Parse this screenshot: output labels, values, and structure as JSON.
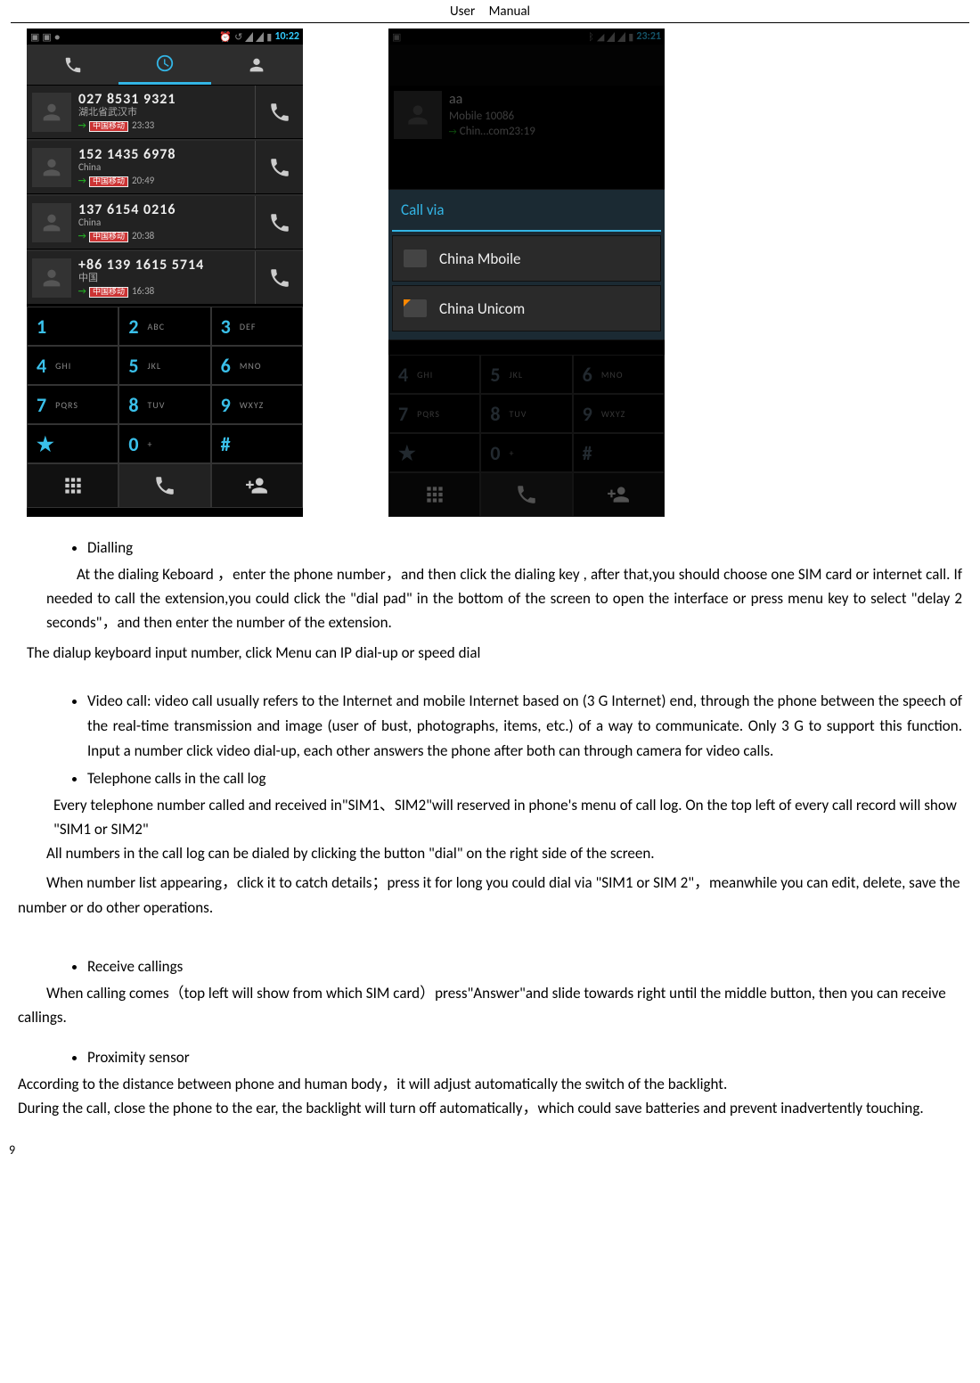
{
  "header": {
    "title": "User Manual"
  },
  "page_number": "9",
  "phone1": {
    "time": "10:22",
    "calls": [
      {
        "num": "027 8531 9321",
        "loc": "湖北省武汉市",
        "tag": "中国移动",
        "time": "23:33"
      },
      {
        "num": "152 1435 6978",
        "loc": "China",
        "tag": "中国移动",
        "time": "20:49"
      },
      {
        "num": "137 6154 0216",
        "loc": "China",
        "tag": "中国移动",
        "time": "20:38"
      },
      {
        "num": "+86 139 1615 5714",
        "loc": "中国",
        "tag": "中国移动",
        "time": "16:38"
      }
    ],
    "keys": [
      [
        "1",
        "",
        "2",
        "ABC",
        "3",
        "DEF"
      ],
      [
        "4",
        "GHI",
        "5",
        "JKL",
        "6",
        "MNO"
      ],
      [
        "7",
        "PQRS",
        "8",
        "TUV",
        "9",
        "WXYZ"
      ],
      [
        "★",
        "",
        "0",
        "+",
        "#",
        ""
      ]
    ]
  },
  "phone2": {
    "time": "23:21",
    "contact": {
      "name": "aa",
      "sub": "Mobile 10086",
      "tag": "Chin…com",
      "ctime": "23:19"
    },
    "dialog": {
      "title": "Call via",
      "opts": [
        "China Mboile",
        "China Unicom"
      ]
    },
    "dimkeys": [
      [
        "4",
        "GHI",
        "5",
        "JKL",
        "6",
        "MNO"
      ],
      [
        "7",
        "PQRS",
        "8",
        "TUV",
        "9",
        "WXYZ"
      ],
      [
        "★",
        "",
        "0",
        "+",
        "#",
        ""
      ]
    ]
  },
  "sections": {
    "dialling": {
      "title": "Dialling",
      "body": "At the dialing Keboard  ，enter the phone number，and then click the dialing key , after that,you should choose one SIM card or internet   call. If needed to call the extension,you could click the \"dial pad\" in the bottom of the screen to open the interface or press menu key to select \"delay 2 seconds\"，and then enter the number of the extension.",
      "note": "The dialup keyboard input number, click Menu can IP dial-up or speed dial"
    },
    "video": {
      "body": "Video call: video call usually refers to the Internet and mobile Internet based on (3 G Internet) end, through the phone between the speech of the real-time transmission and image (user of bust, photographs, items, etc.) of a way to communicate. Only 3 G to support this function. Input a number click video dial-up, each other answers the phone after both can through camera for video calls."
    },
    "calllog": {
      "title": "Telephone calls in the call log",
      "p1": "Every telephone number called and received in\"SIM1、SIM2\"will reserved in phone's menu of call log. On the top left of every call record will show \"SIM1 or SIM2\"",
      "p2": "All numbers in the call log can be dialed by clicking the button \"dial\" on the right side of the screen.",
      "p3": "When number list appearing，click it to catch details；press it for long you could dial via \"SIM1 or SIM 2\"，meanwhile you can edit, delete, save the number or do other operations."
    },
    "receive": {
      "title": "Receive callings",
      "body": "When calling comes（top left will show from which SIM card）press\"Answer\"and slide towards right until the middle button, then you can receive callings."
    },
    "proximity": {
      "title": "Proximity sensor",
      "p1": "According to the distance between phone and human body，it will adjust automatically the switch of the backlight.",
      "p2": "During the call, close the phone to the ear, the backlight will turn off automatically，which could save batteries and prevent inadvertently touching."
    }
  }
}
